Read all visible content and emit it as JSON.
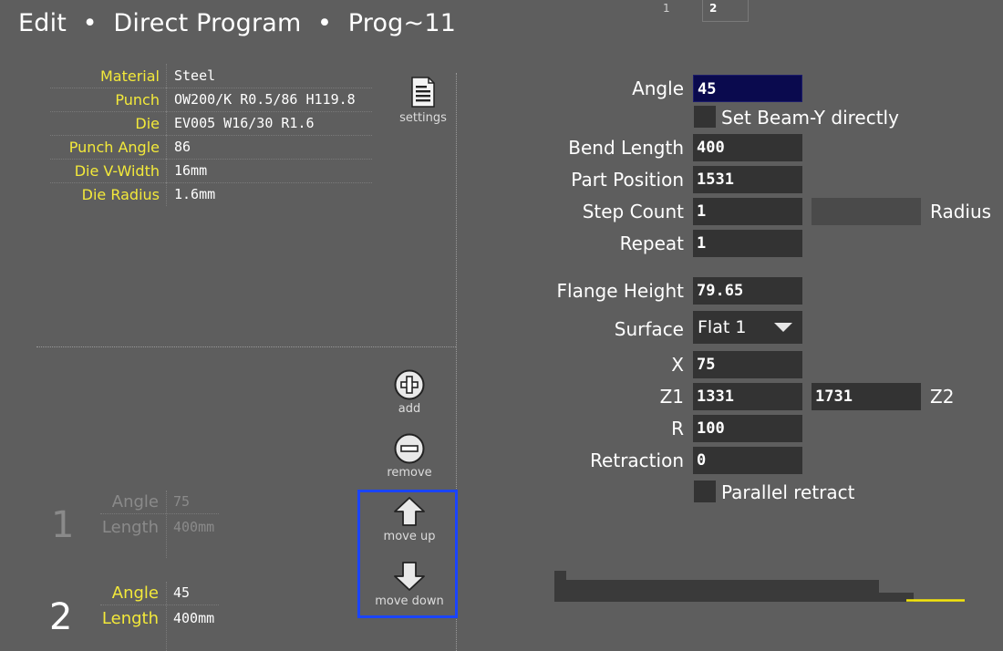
{
  "header": {
    "title": "Edit  •  Direct Program  •  Prog~11"
  },
  "page_tabs": [
    {
      "label": "1"
    },
    {
      "label": "2"
    }
  ],
  "material_info": [
    {
      "label": "Material",
      "value": "Steel"
    },
    {
      "label": "Punch",
      "value": "OW200/K R0.5/86 H119.8"
    },
    {
      "label": "Die",
      "value": "EV005 W16/30 R1.6"
    },
    {
      "label": "Punch Angle",
      "value": "86"
    },
    {
      "label": "Die V-Width",
      "value": "16mm"
    },
    {
      "label": "Die Radius",
      "value": "1.6mm"
    }
  ],
  "tools": {
    "settings": "settings",
    "add": "add",
    "remove": "remove",
    "move_up": "move up",
    "move_down": "move down"
  },
  "bends": [
    {
      "number": "1",
      "angle_label": "Angle",
      "angle": "75",
      "length_label": "Length",
      "length": "400mm",
      "selected": false
    },
    {
      "number": "2",
      "angle_label": "Angle",
      "angle": "45",
      "length_label": "Length",
      "length": "400mm",
      "selected": true
    }
  ],
  "form": {
    "angle_label": "Angle",
    "angle": "45",
    "set_beam_label": "Set Beam-Y directly",
    "bend_length_label": "Bend Length",
    "bend_length": "400",
    "part_position_label": "Part Position",
    "part_position": "1531",
    "step_count_label": "Step Count",
    "step_count": "1",
    "radius_label": "Radius",
    "radius": "",
    "repeat_label": "Repeat",
    "repeat": "1",
    "flange_height_label": "Flange Height",
    "flange_height": "79.65",
    "surface_label": "Surface",
    "surface": "Flat 1",
    "x_label": "X",
    "x": "75",
    "z1_label": "Z1",
    "z1": "1331",
    "z2_label": "Z2",
    "z2": "1731",
    "r_label": "R",
    "r": "100",
    "retraction_label": "Retraction",
    "retraction": "0",
    "parallel_retract_label": "Parallel retract"
  },
  "colors": {
    "background": "#5e5e5e",
    "label_yellow": "#f3e93a",
    "field_bg": "#333333",
    "focus_field": "#0a0a4e",
    "selection_border": "#1a44ff",
    "preview_line": "#f5e60a"
  }
}
